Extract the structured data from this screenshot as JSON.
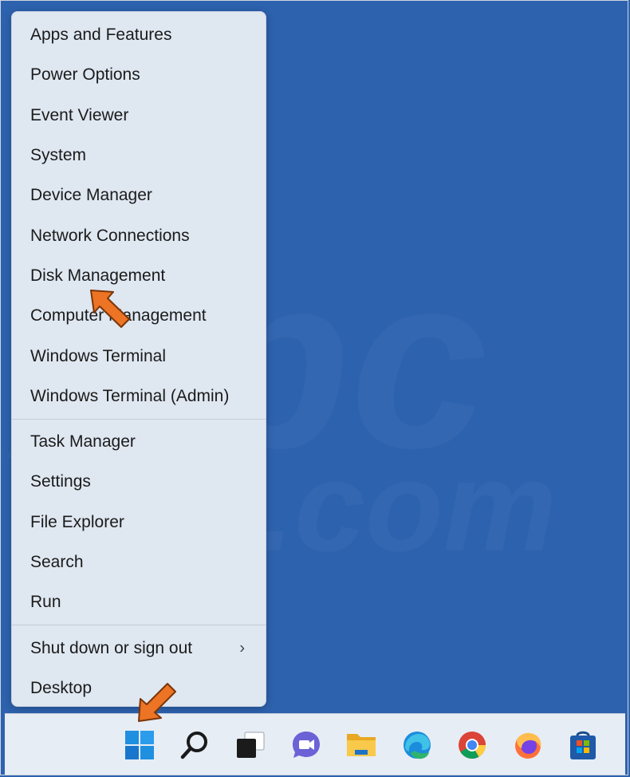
{
  "menu": {
    "group1": [
      {
        "label": "Apps and Features"
      },
      {
        "label": "Power Options"
      },
      {
        "label": "Event Viewer"
      },
      {
        "label": "System"
      },
      {
        "label": "Device Manager"
      },
      {
        "label": "Network Connections"
      },
      {
        "label": "Disk Management"
      },
      {
        "label": "Computer Management"
      },
      {
        "label": "Windows Terminal"
      },
      {
        "label": "Windows Terminal (Admin)"
      }
    ],
    "group2": [
      {
        "label": "Task Manager"
      },
      {
        "label": "Settings"
      },
      {
        "label": "File Explorer"
      },
      {
        "label": "Search"
      },
      {
        "label": "Run"
      }
    ],
    "group3": [
      {
        "label": "Shut down or sign out",
        "submenu_glyph": "›"
      },
      {
        "label": "Desktop"
      }
    ]
  },
  "taskbar": {
    "icons": [
      "windows-start-icon",
      "search-icon",
      "task-view-icon",
      "teams-chat-icon",
      "file-explorer-icon",
      "edge-icon",
      "chrome-icon",
      "firefox-icon",
      "microsoft-store-icon"
    ]
  },
  "colors": {
    "desktop": "#2d62ae",
    "menu_bg": "#dfe7f1",
    "taskbar_bg": "#e6edf5",
    "arrow": "#ec7424"
  }
}
